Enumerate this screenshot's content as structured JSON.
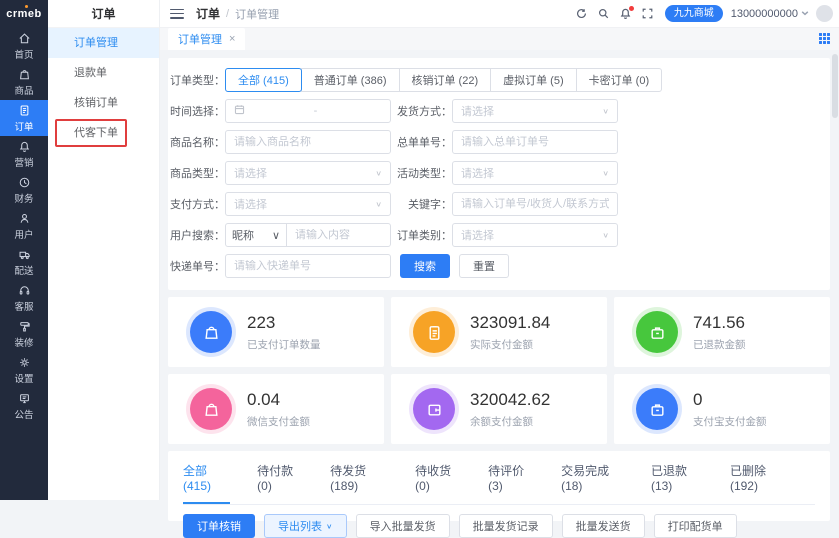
{
  "app": {
    "logo": "crmeb",
    "module_title": "订单"
  },
  "topbar": {
    "breadcrumb_root": "订单",
    "breadcrumb_sep": "/",
    "breadcrumb_current": "订单管理",
    "shop_name": "九九商城",
    "phone": "13000000000"
  },
  "tabbar": {
    "active_tab": "订单管理",
    "close_glyph": "×"
  },
  "sidebar": {
    "items": [
      {
        "label": "首页"
      },
      {
        "label": "商品"
      },
      {
        "label": "订单"
      },
      {
        "label": "营销"
      },
      {
        "label": "财务"
      },
      {
        "label": "用户"
      },
      {
        "label": "配送"
      },
      {
        "label": "客服"
      },
      {
        "label": "装修"
      },
      {
        "label": "设置"
      },
      {
        "label": "公告"
      }
    ]
  },
  "submenu": {
    "items": [
      {
        "label": "订单管理"
      },
      {
        "label": "退款单"
      },
      {
        "label": "核销订单"
      },
      {
        "label": "代客下单"
      }
    ]
  },
  "filter": {
    "type_label": "订单类型：",
    "types": [
      {
        "label": "全部 (415)"
      },
      {
        "label": "普通订单 (386)"
      },
      {
        "label": "核销订单 (22)"
      },
      {
        "label": "虚拟订单 (5)"
      },
      {
        "label": "卡密订单 (0)"
      }
    ],
    "time": {
      "label": "时间选择：",
      "separator": "-"
    },
    "delivery": {
      "label": "发货方式：",
      "placeholder": "请选择"
    },
    "product_name": {
      "label": "商品名称：",
      "placeholder": "请输入商品名称"
    },
    "master_order": {
      "label": "总单单号：",
      "placeholder": "请输入总单订单号"
    },
    "product_type": {
      "label": "商品类型：",
      "placeholder": "请选择"
    },
    "activity_type": {
      "label": "活动类型：",
      "placeholder": "请选择"
    },
    "pay_method": {
      "label": "支付方式：",
      "placeholder": "请选择"
    },
    "keyword": {
      "label": "关键字：",
      "placeholder": "请输入订单号/收货人/联系方式"
    },
    "user_search": {
      "label": "用户搜索：",
      "select_value": "昵称",
      "placeholder": "请输入内容"
    },
    "order_category": {
      "label": "订单类别：",
      "placeholder": "请选择"
    },
    "express_no": {
      "label": "快递单号：",
      "placeholder": "请输入快递单号"
    },
    "search_button": "搜索",
    "reset_button": "重置"
  },
  "stats": [
    {
      "value": "223",
      "label": "已支付订单数量",
      "color": "#3b7cfa",
      "icon": "bag-icon"
    },
    {
      "value": "323091.84",
      "label": "实际支付金额",
      "color": "#f7a326",
      "icon": "clipboard-icon"
    },
    {
      "value": "741.56",
      "label": "已退款金额",
      "color": "#47c73d",
      "icon": "briefcase-icon"
    },
    {
      "value": "0.04",
      "label": "微信支付金额",
      "color": "#f4649c",
      "icon": "bag-icon"
    },
    {
      "value": "320042.62",
      "label": "余额支付金额",
      "color": "#a368f0",
      "icon": "wallet-icon"
    },
    {
      "value": "0",
      "label": "支付宝支付金额",
      "color": "#3b7cfa",
      "icon": "briefcase-icon"
    }
  ],
  "status_tabs": [
    {
      "label": "全部(415)"
    },
    {
      "label": "待付款(0)"
    },
    {
      "label": "待发货(189)"
    },
    {
      "label": "待收货(0)"
    },
    {
      "label": "待评价(3)"
    },
    {
      "label": "交易完成(18)"
    },
    {
      "label": "已退款(13)"
    },
    {
      "label": "已删除(192)"
    }
  ],
  "actions": [
    {
      "label": "订单核销"
    },
    {
      "label": "导出列表"
    },
    {
      "label": "导入批量发货"
    },
    {
      "label": "批量发货记录"
    },
    {
      "label": "批量发送货"
    },
    {
      "label": "打印配货单"
    }
  ],
  "glyphs": {
    "chevron_down": "∨"
  },
  "colors": {
    "accent": "#2d7df5",
    "sidebar_bg": "#222a3c",
    "highlight_box": "#e03e3e"
  }
}
